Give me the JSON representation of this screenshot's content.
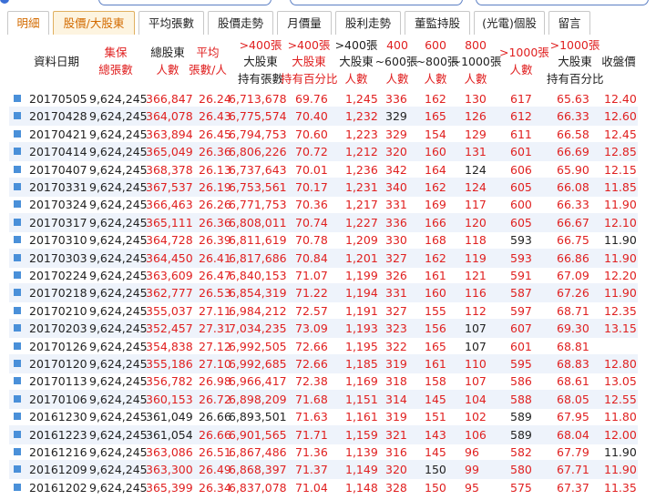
{
  "tabs": [
    "明細",
    "股價/大股東",
    "平均張數",
    "股價走勢",
    "月價量",
    "股利走勢",
    "董監持股",
    "(光電)個股",
    "留言"
  ],
  "header": {
    "date": "資料日期",
    "shares1": "集保",
    "shares2": "總張數",
    "holders1": "總股東",
    "holders2": "人數",
    "avg1": "平均",
    "avg2": "張數/人",
    "big1": ">400張",
    "big2": "大股東",
    "big3": "持有張數",
    "pct1": ">400張",
    "pct2": "大股東",
    "pct3": "持有百分比",
    "ppl1": ">400張",
    "ppl2": "大股東",
    "ppl3": "人數",
    "r400a": "400",
    "r400b": "~600張",
    "r400c": "人數",
    "r600a": "600",
    "r600b": "~800張",
    "r600c": "人數",
    "r800a": "800",
    "r800b": "~1000張",
    "r800c": "人數",
    "k1a": ">1000張",
    "k1b": "人數",
    "k2a": ">1000張",
    "k2b": "大股東",
    "k2c": "持有百分比",
    "close": "收盤價"
  },
  "rows": [
    {
      "date": "20170505",
      "shares": "9,624,245",
      "holders": "366,847",
      "avg": "26.24",
      "big": "6,713,678",
      "pct": "69.76",
      "ppl": "1,245",
      "r4": "336",
      "r6": "162",
      "r8": "130",
      "k1": "617",
      "k2": "65.63",
      "close": "12.40"
    },
    {
      "date": "20170428",
      "shares": "9,624,245",
      "holders": "364,078",
      "avg": "26.43",
      "big": "6,775,574",
      "pct": "70.40",
      "ppl": "1,232",
      "r4": "329",
      "r6": "165",
      "r8": "126",
      "k1": "612",
      "k2": "66.33",
      "close": "12.60"
    },
    {
      "date": "20170421",
      "shares": "9,624,245",
      "holders": "363,894",
      "avg": "26.45",
      "big": "6,794,753",
      "pct": "70.60",
      "ppl": "1,223",
      "r4": "329",
      "r6": "154",
      "r8": "129",
      "k1": "611",
      "k2": "66.58",
      "close": "12.45"
    },
    {
      "date": "20170414",
      "shares": "9,624,245",
      "holders": "365,049",
      "avg": "26.36",
      "big": "6,806,226",
      "pct": "70.72",
      "ppl": "1,212",
      "r4": "320",
      "r6": "160",
      "r8": "131",
      "k1": "601",
      "k2": "66.69",
      "close": "12.85"
    },
    {
      "date": "20170407",
      "shares": "9,624,245",
      "holders": "368,378",
      "avg": "26.13",
      "big": "6,737,643",
      "pct": "70.01",
      "ppl": "1,236",
      "r4": "342",
      "r6": "164",
      "r8": "124",
      "k1": "606",
      "k2": "65.90",
      "close": "12.15"
    },
    {
      "date": "20170331",
      "shares": "9,624,245",
      "holders": "367,537",
      "avg": "26.19",
      "big": "6,753,561",
      "pct": "70.17",
      "ppl": "1,231",
      "r4": "340",
      "r6": "162",
      "r8": "124",
      "k1": "605",
      "k2": "66.08",
      "close": "11.85"
    },
    {
      "date": "20170324",
      "shares": "9,624,245",
      "holders": "366,463",
      "avg": "26.26",
      "big": "6,771,753",
      "pct": "70.36",
      "ppl": "1,217",
      "r4": "331",
      "r6": "169",
      "r8": "117",
      "k1": "600",
      "k2": "66.33",
      "close": "11.90"
    },
    {
      "date": "20170317",
      "shares": "9,624,245",
      "holders": "365,111",
      "avg": "26.36",
      "big": "6,808,011",
      "pct": "70.74",
      "ppl": "1,227",
      "r4": "336",
      "r6": "166",
      "r8": "120",
      "k1": "605",
      "k2": "66.67",
      "close": "12.10"
    },
    {
      "date": "20170310",
      "shares": "9,624,245",
      "holders": "364,728",
      "avg": "26.39",
      "big": "6,811,619",
      "pct": "70.78",
      "ppl": "1,209",
      "r4": "330",
      "r6": "168",
      "r8": "118",
      "k1": "593",
      "k2": "66.75",
      "close": "11.90"
    },
    {
      "date": "20170303",
      "shares": "9,624,245",
      "holders": "364,450",
      "avg": "26.41",
      "big": "6,817,686",
      "pct": "70.84",
      "ppl": "1,201",
      "r4": "327",
      "r6": "162",
      "r8": "119",
      "k1": "593",
      "k2": "66.86",
      "close": "11.90"
    },
    {
      "date": "20170224",
      "shares": "9,624,245",
      "holders": "363,609",
      "avg": "26.47",
      "big": "6,840,153",
      "pct": "71.07",
      "ppl": "1,199",
      "r4": "326",
      "r6": "161",
      "r8": "121",
      "k1": "591",
      "k2": "67.09",
      "close": "12.20"
    },
    {
      "date": "20170218",
      "shares": "9,624,245",
      "holders": "362,777",
      "avg": "26.53",
      "big": "6,854,319",
      "pct": "71.22",
      "ppl": "1,194",
      "r4": "331",
      "r6": "160",
      "r8": "116",
      "k1": "587",
      "k2": "67.26",
      "close": "11.90"
    },
    {
      "date": "20170210",
      "shares": "9,624,245",
      "holders": "355,037",
      "avg": "27.11",
      "big": "6,984,212",
      "pct": "72.57",
      "ppl": "1,191",
      "r4": "327",
      "r6": "155",
      "r8": "112",
      "k1": "597",
      "k2": "68.71",
      "close": "12.35"
    },
    {
      "date": "20170203",
      "shares": "9,624,245",
      "holders": "352,457",
      "avg": "27.31",
      "big": "7,034,235",
      "pct": "73.09",
      "ppl": "1,193",
      "r4": "323",
      "r6": "156",
      "r8": "107",
      "k1": "607",
      "k2": "69.30",
      "close": "13.15"
    },
    {
      "date": "20170126",
      "shares": "9,624,245",
      "holders": "354,838",
      "avg": "27.12",
      "big": "6,992,505",
      "pct": "72.66",
      "ppl": "1,195",
      "r4": "322",
      "r6": "165",
      "r8": "107",
      "k1": "601",
      "k2": "68.81",
      "close": ""
    },
    {
      "date": "20170120",
      "shares": "9,624,245",
      "holders": "355,186",
      "avg": "27.10",
      "big": "6,992,685",
      "pct": "72.66",
      "ppl": "1,185",
      "r4": "319",
      "r6": "161",
      "r8": "110",
      "k1": "595",
      "k2": "68.83",
      "close": "12.80"
    },
    {
      "date": "20170113",
      "shares": "9,624,245",
      "holders": "356,782",
      "avg": "26.98",
      "big": "6,966,417",
      "pct": "72.38",
      "ppl": "1,169",
      "r4": "318",
      "r6": "158",
      "r8": "107",
      "k1": "586",
      "k2": "68.61",
      "close": "13.05"
    },
    {
      "date": "20170106",
      "shares": "9,624,245",
      "holders": "360,153",
      "avg": "26.72",
      "big": "6,898,209",
      "pct": "71.68",
      "ppl": "1,151",
      "r4": "314",
      "r6": "145",
      "r8": "104",
      "k1": "588",
      "k2": "68.05",
      "close": "12.55"
    },
    {
      "date": "20161230",
      "shares": "9,624,245",
      "holders": "361,049",
      "avg": "26.66",
      "big": "6,893,501",
      "pct": "71.63",
      "ppl": "1,161",
      "r4": "319",
      "r6": "151",
      "r8": "102",
      "k1": "589",
      "k2": "67.95",
      "close": "11.80"
    },
    {
      "date": "20161223",
      "shares": "9,624,245",
      "holders": "361,054",
      "avg": "26.66",
      "big": "6,901,565",
      "pct": "71.71",
      "ppl": "1,159",
      "r4": "321",
      "r6": "143",
      "r8": "106",
      "k1": "589",
      "k2": "68.04",
      "close": "12.00"
    },
    {
      "date": "20161216",
      "shares": "9,624,245",
      "holders": "363,086",
      "avg": "26.51",
      "big": "6,867,486",
      "pct": "71.36",
      "ppl": "1,139",
      "r4": "316",
      "r6": "145",
      "r8": "96",
      "k1": "582",
      "k2": "67.79",
      "close": "11.90"
    },
    {
      "date": "20161209",
      "shares": "9,624,245",
      "holders": "363,300",
      "avg": "26.49",
      "big": "6,868,397",
      "pct": "71.37",
      "ppl": "1,149",
      "r4": "320",
      "r6": "150",
      "r8": "99",
      "k1": "580",
      "k2": "67.71",
      "close": "11.90"
    },
    {
      "date": "20161202",
      "shares": "9,624,245",
      "holders": "365,399",
      "avg": "26.34",
      "big": "6,837,078",
      "pct": "71.04",
      "ppl": "1,148",
      "r4": "328",
      "r6": "150",
      "r8": "95",
      "k1": "575",
      "k2": "67.37",
      "close": "11.35"
    }
  ],
  "colors": {
    "red": "#e02020",
    "black": "#222222",
    "rowBand": "#eef3fb",
    "accent": "#d36b00",
    "marker": "#4a90d9"
  },
  "rowColors": [
    {
      "holders": "r",
      "avg": "r",
      "big": "r",
      "pct": "r",
      "ppl": "r",
      "r4": "r",
      "r6": "r",
      "r8": "r",
      "k1": "r",
      "k2": "r",
      "close": "r"
    },
    {
      "holders": "r",
      "avg": "r",
      "big": "r",
      "pct": "r",
      "ppl": "r",
      "r4": "b",
      "r6": "r",
      "r8": "r",
      "k1": "r",
      "k2": "r",
      "close": "r"
    },
    {
      "holders": "r",
      "avg": "r",
      "big": "r",
      "pct": "r",
      "ppl": "r",
      "r4": "r",
      "r6": "r",
      "r8": "r",
      "k1": "r",
      "k2": "r",
      "close": "r"
    },
    {
      "holders": "r",
      "avg": "r",
      "big": "r",
      "pct": "r",
      "ppl": "r",
      "r4": "r",
      "r6": "r",
      "r8": "r",
      "k1": "r",
      "k2": "r",
      "close": "r"
    },
    {
      "holders": "r",
      "avg": "r",
      "big": "r",
      "pct": "r",
      "ppl": "r",
      "r4": "r",
      "r6": "r",
      "r8": "b",
      "k1": "r",
      "k2": "r",
      "close": "r"
    },
    {
      "holders": "r",
      "avg": "r",
      "big": "r",
      "pct": "r",
      "ppl": "r",
      "r4": "r",
      "r6": "r",
      "r8": "r",
      "k1": "r",
      "k2": "r",
      "close": "r"
    },
    {
      "holders": "r",
      "avg": "r",
      "big": "r",
      "pct": "r",
      "ppl": "r",
      "r4": "r",
      "r6": "r",
      "r8": "r",
      "k1": "r",
      "k2": "r",
      "close": "r"
    },
    {
      "holders": "r",
      "avg": "r",
      "big": "r",
      "pct": "r",
      "ppl": "r",
      "r4": "r",
      "r6": "r",
      "r8": "r",
      "k1": "r",
      "k2": "r",
      "close": "r"
    },
    {
      "holders": "r",
      "avg": "r",
      "big": "r",
      "pct": "r",
      "ppl": "r",
      "r4": "r",
      "r6": "r",
      "r8": "r",
      "k1": "b",
      "k2": "r",
      "close": "b"
    },
    {
      "holders": "r",
      "avg": "r",
      "big": "r",
      "pct": "r",
      "ppl": "r",
      "r4": "r",
      "r6": "r",
      "r8": "r",
      "k1": "r",
      "k2": "r",
      "close": "r"
    },
    {
      "holders": "r",
      "avg": "r",
      "big": "r",
      "pct": "r",
      "ppl": "r",
      "r4": "r",
      "r6": "r",
      "r8": "r",
      "k1": "r",
      "k2": "r",
      "close": "r"
    },
    {
      "holders": "r",
      "avg": "r",
      "big": "r",
      "pct": "r",
      "ppl": "r",
      "r4": "r",
      "r6": "r",
      "r8": "r",
      "k1": "r",
      "k2": "r",
      "close": "r"
    },
    {
      "holders": "r",
      "avg": "r",
      "big": "r",
      "pct": "r",
      "ppl": "r",
      "r4": "r",
      "r6": "r",
      "r8": "r",
      "k1": "r",
      "k2": "r",
      "close": "r"
    },
    {
      "holders": "r",
      "avg": "r",
      "big": "r",
      "pct": "r",
      "ppl": "r",
      "r4": "r",
      "r6": "r",
      "r8": "b",
      "k1": "r",
      "k2": "r",
      "close": "r"
    },
    {
      "holders": "r",
      "avg": "r",
      "big": "r",
      "pct": "r",
      "ppl": "r",
      "r4": "r",
      "r6": "r",
      "r8": "b",
      "k1": "r",
      "k2": "r",
      "close": "r"
    },
    {
      "holders": "r",
      "avg": "r",
      "big": "r",
      "pct": "r",
      "ppl": "r",
      "r4": "r",
      "r6": "r",
      "r8": "r",
      "k1": "r",
      "k2": "r",
      "close": "r"
    },
    {
      "holders": "r",
      "avg": "r",
      "big": "r",
      "pct": "r",
      "ppl": "r",
      "r4": "r",
      "r6": "r",
      "r8": "r",
      "k1": "r",
      "k2": "r",
      "close": "r"
    },
    {
      "holders": "r",
      "avg": "r",
      "big": "r",
      "pct": "r",
      "ppl": "r",
      "r4": "r",
      "r6": "r",
      "r8": "r",
      "k1": "r",
      "k2": "r",
      "close": "r"
    },
    {
      "holders": "b",
      "avg": "b",
      "big": "b",
      "pct": "r",
      "ppl": "r",
      "r4": "r",
      "r6": "r",
      "r8": "r",
      "k1": "b",
      "k2": "r",
      "close": "r"
    },
    {
      "holders": "b",
      "avg": "r",
      "big": "r",
      "pct": "r",
      "ppl": "r",
      "r4": "r",
      "r6": "r",
      "r8": "r",
      "k1": "b",
      "k2": "r",
      "close": "r"
    },
    {
      "holders": "r",
      "avg": "r",
      "big": "r",
      "pct": "r",
      "ppl": "r",
      "r4": "r",
      "r6": "r",
      "r8": "r",
      "k1": "r",
      "k2": "r",
      "close": "b"
    },
    {
      "holders": "r",
      "avg": "r",
      "big": "r",
      "pct": "r",
      "ppl": "r",
      "r4": "r",
      "r6": "b",
      "r8": "r",
      "k1": "r",
      "k2": "r",
      "close": "r"
    },
    {
      "holders": "r",
      "avg": "r",
      "big": "r",
      "pct": "r",
      "ppl": "r",
      "r4": "r",
      "r6": "r",
      "r8": "r",
      "k1": "r",
      "k2": "r",
      "close": "r"
    }
  ]
}
